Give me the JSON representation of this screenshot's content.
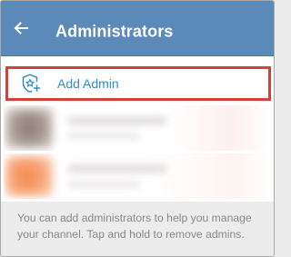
{
  "header": {
    "title": "Administrators",
    "back_icon": "arrow-left-icon",
    "background_color": "#5b8ab8"
  },
  "add_admin": {
    "label": "Add Admin",
    "icon": "shield-star-plus-icon",
    "highlight_color": "#d0423a",
    "accent_color": "#2f8cd0"
  },
  "footer": {
    "text": "You can add administrators to help you manage your channel. Tap and hold to remove admins."
  }
}
